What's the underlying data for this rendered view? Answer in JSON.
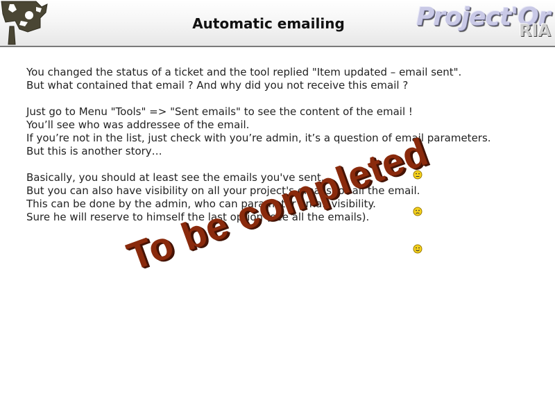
{
  "header": {
    "title": "Automatic emailing",
    "brand_main": "Project'Or",
    "brand_sub": "RIA"
  },
  "paragraphs": [
    {
      "lines": [
        "You changed the status of a ticket and the tool replied \"Item updated – email sent\".",
        "But what contained that email ? And why did you not receive this email ?"
      ]
    },
    {
      "lines": [
        "Just go to Menu \"Tools\" => \"Sent emails\" to see the content of the email !",
        "You’ll see who was addressee of the email.",
        "If you’re not in the list, just check with you’re admin, it’s a question of email parameters.",
        "But this is another story…"
      ]
    },
    {
      "lines": [
        "Basically, you should at least see the emails you've sent.",
        "But you can also have visibility on all your project's emails, or all the email.",
        "This can be done by the admin, who can parameter email visibility.",
        "Sure he will reserve to himself the last option (see all the emails)."
      ]
    }
  ],
  "watermark": "To be completed",
  "icons": {
    "logo": "camera-icon",
    "smileys": [
      "smiley-neutral-icon",
      "smiley-confused-icon",
      "smiley-happy-icon"
    ]
  },
  "colors": {
    "watermark": "#8a2a0c",
    "smiley_fill": "#f6d21c",
    "logo": "#4a4634"
  }
}
